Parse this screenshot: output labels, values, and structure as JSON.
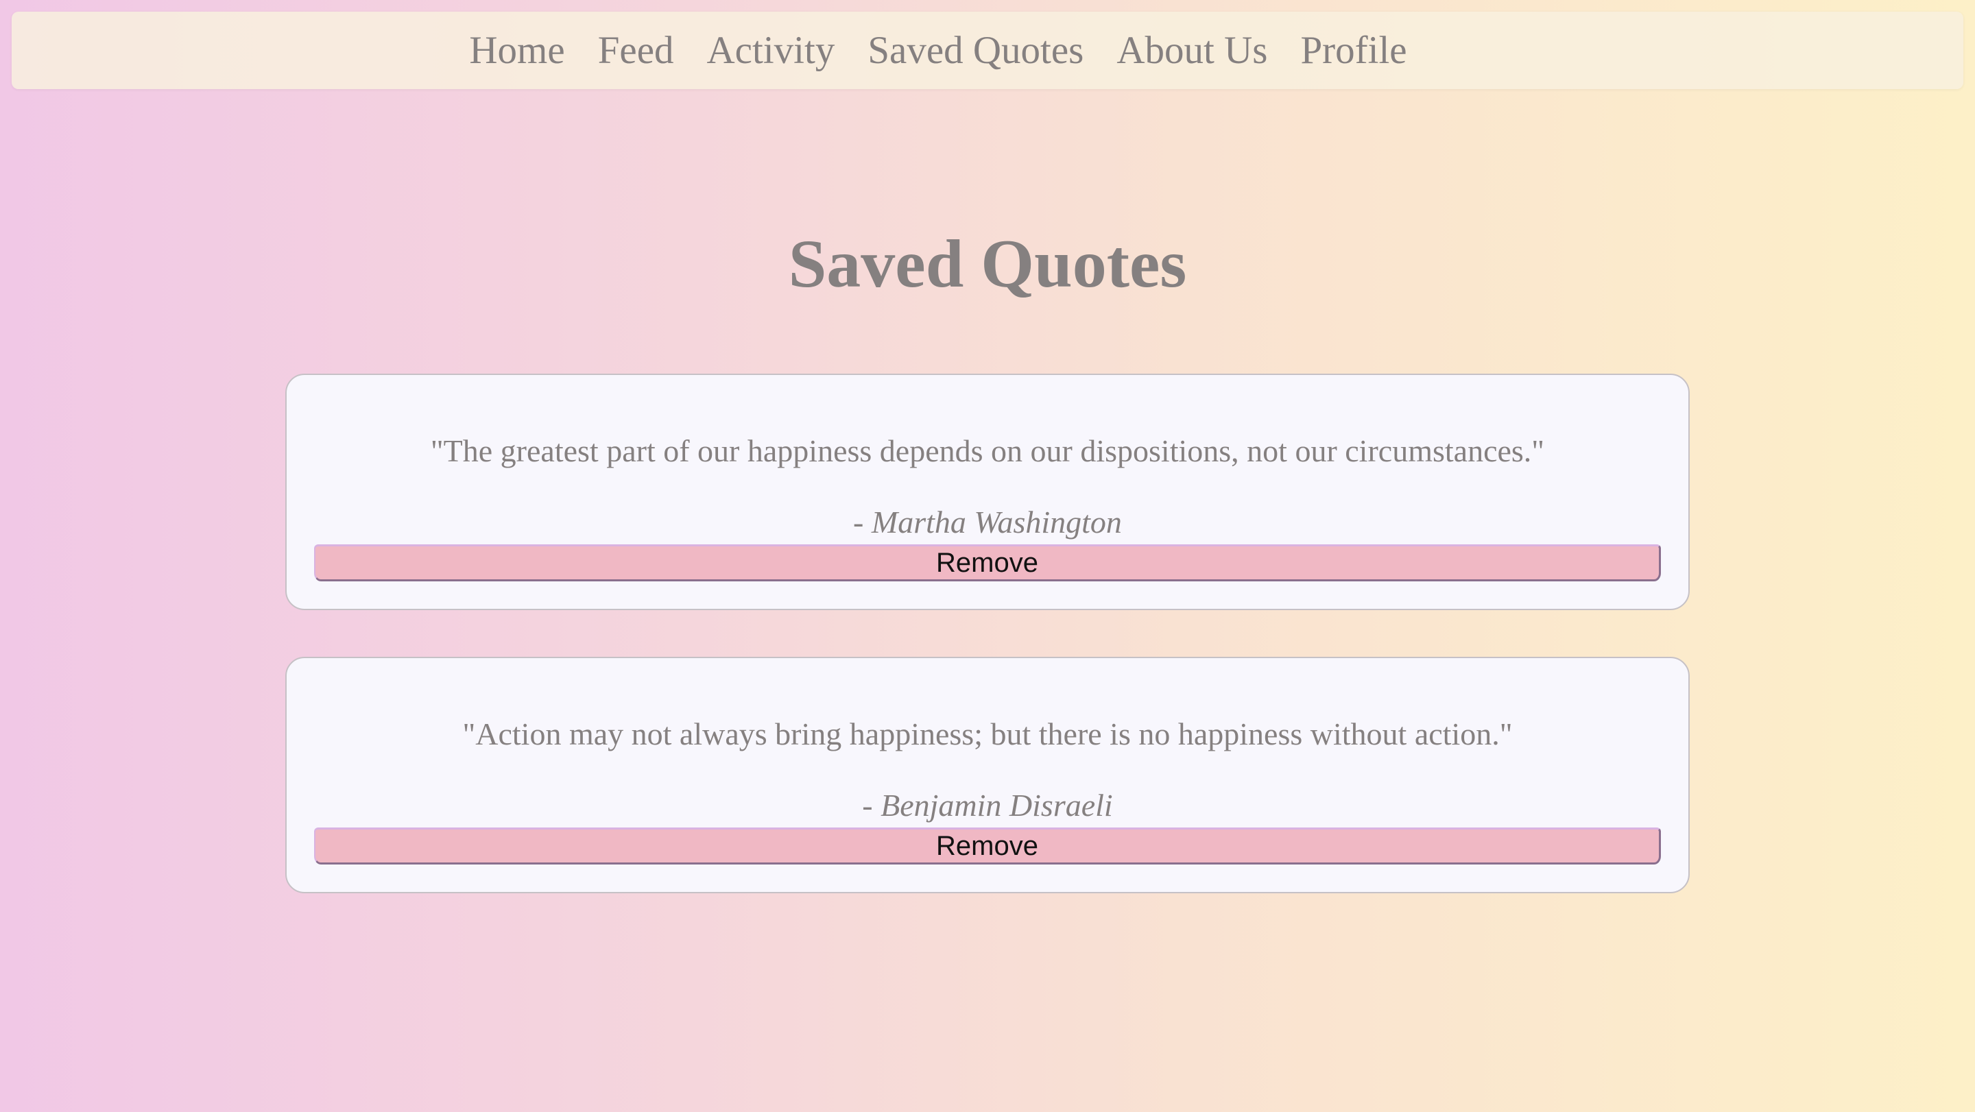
{
  "nav": {
    "items": [
      {
        "label": "Home"
      },
      {
        "label": "Feed"
      },
      {
        "label": "Activity"
      },
      {
        "label": "Saved Quotes"
      },
      {
        "label": "About Us"
      },
      {
        "label": "Profile"
      }
    ]
  },
  "page": {
    "title": "Saved Quotes"
  },
  "quotes": [
    {
      "text": "\"The greatest part of our happiness depends on our dispositions, not our circumstances.\"",
      "dash": "- ",
      "author": "Martha Washington",
      "remove_label": "Remove"
    },
    {
      "text": "\"Action may not always bring happiness; but there is no happiness without action.\"",
      "dash": "- ",
      "author": "Benjamin Disraeli",
      "remove_label": "Remove"
    }
  ],
  "colors": {
    "text": "#858080",
    "card_background": "#f8f7fd",
    "button_background": "#f0b8c4",
    "navbar_background": "#f8f0de"
  }
}
